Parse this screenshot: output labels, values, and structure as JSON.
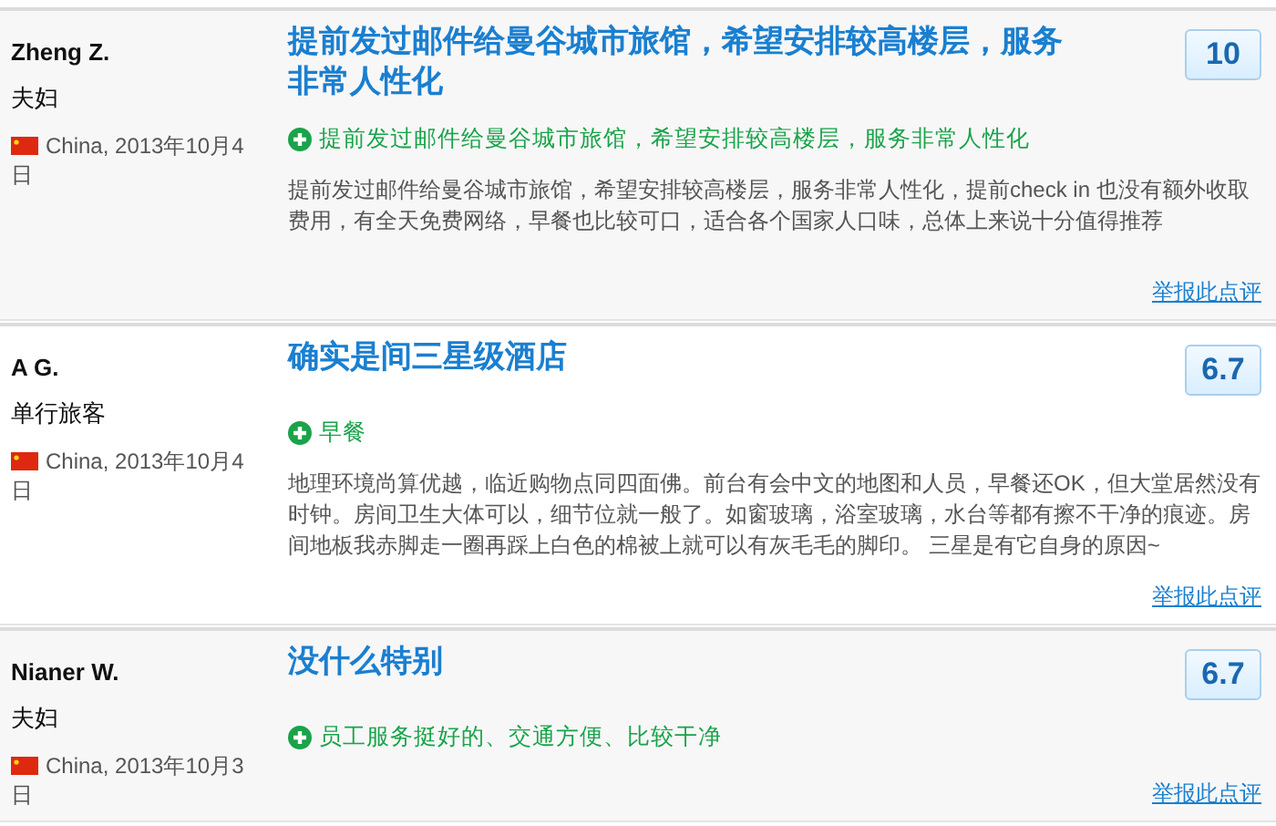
{
  "reviews": [
    {
      "reviewer": "Zheng Z.",
      "traveler_type": "夫妇",
      "origin": "China, 2013年10月4日",
      "title": "提前发过邮件给曼谷城市旅馆，希望安排较高楼层，服务非常人性化",
      "score": "10",
      "highlights": [
        {
          "kind": "positive",
          "text": "提前发过邮件给曼谷城市旅馆，希望安排较高楼层，服务非常人性化"
        }
      ],
      "body": "提前发过邮件给曼谷城市旅馆，希望安排较高楼层，服务非常人性化，提前check in 也没有额外收取费用，有全天免费网络，早餐也比较可口，适合各个国家人口味，总体上来说十分值得推荐",
      "report_link": "举报此点评"
    },
    {
      "reviewer": "A G.",
      "traveler_type": "单行旅客",
      "origin": "China, 2013年10月4日",
      "title": "确实是间三星级酒店",
      "score": "6.7",
      "highlights": [
        {
          "kind": "positive",
          "text": "早餐"
        }
      ],
      "body": "地理环境尚算优越，临近购物点同四面佛。前台有会中文的地图和人员，早餐还OK，但大堂居然没有时钟。房间卫生大体可以，细节位就一般了。如窗玻璃，浴室玻璃，水台等都有擦不干净的痕迹。房间地板我赤脚走一圈再踩上白色的棉被上就可以有灰毛毛的脚印。 三星是有它自身的原因~",
      "report_link": "举报此点评"
    },
    {
      "reviewer": "Nianer W.",
      "traveler_type": "夫妇",
      "origin": "China, 2013年10月3日",
      "title": "没什么特别",
      "score": "6.7",
      "highlights": [
        {
          "kind": "positive",
          "text": "员工服务挺好的、交通方便、比较干净"
        }
      ],
      "report_link": "举报此点评"
    }
  ]
}
